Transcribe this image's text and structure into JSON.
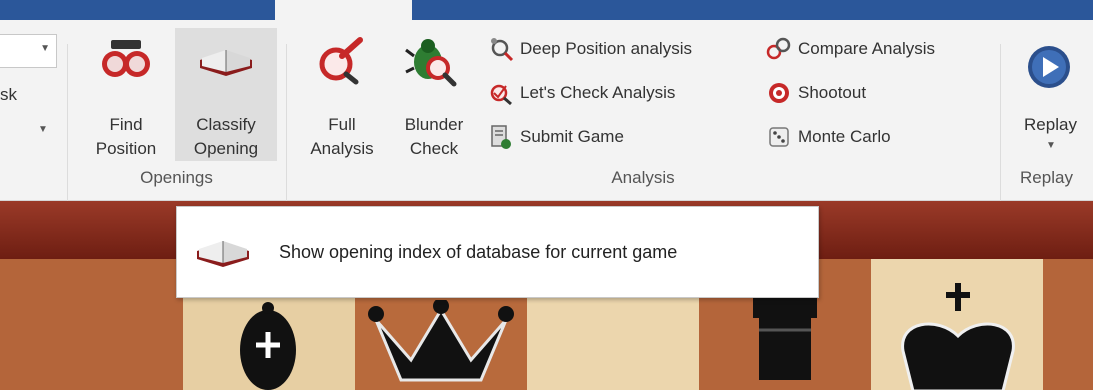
{
  "ribbon": {
    "left_cutoff": {
      "label": "sk"
    },
    "openings": {
      "find_position": {
        "line1": "Find",
        "line2": "Position"
      },
      "classify_opening": {
        "line1": "Classify",
        "line2": "Opening"
      },
      "group_label": "Openings"
    },
    "analysis": {
      "full_analysis": {
        "line1": "Full",
        "line2": "Analysis"
      },
      "blunder_check": {
        "line1": "Blunder",
        "line2": "Check"
      },
      "deep_position": "Deep Position analysis",
      "lets_check": "Let's Check Analysis",
      "submit_game": "Submit Game",
      "compare_analysis": "Compare Analysis",
      "shootout": "Shootout",
      "monte_carlo": "Monte Carlo",
      "group_label": "Analysis"
    },
    "replay": {
      "label": "Replay",
      "group_label": "Replay"
    }
  },
  "tooltip": {
    "text": "Show opening index of database for current game"
  },
  "colors": {
    "title_bar": "#2b579a",
    "ribbon_bg": "#f3f3f3",
    "selected_button": "#dedede",
    "board_frame": "#7a2316"
  }
}
